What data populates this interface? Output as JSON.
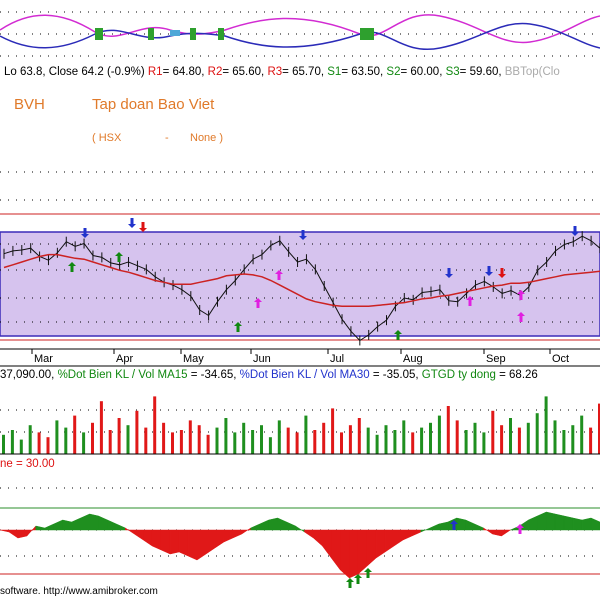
{
  "header": {
    "lo": "Lo 63.8,",
    "close": "Close 64.2 (-0.9%)",
    "r1_label": "R1",
    "r1": "= 64.80,",
    "r2_label": "R2",
    "r2": "= 65.60,",
    "r3_label": "R3",
    "r3": "= 65.70,",
    "s1_label": "S1",
    "s1": "= 63.50,",
    "s2_label": "S2",
    "s2": "= 60.00,",
    "s3_label": "S3",
    "s3": "= 59.60,",
    "bbtop": "BBTop(Clo"
  },
  "ticker": {
    "symbol": "BVH",
    "company": "Tap doan Bao Viet",
    "exchange": "( HSX",
    "dash": "-",
    "sector": "None )"
  },
  "volume_header": {
    "vol": "37,090.00,",
    "ma15_label": "%Dot Bien KL / Vol MA15",
    "ma15": "= -34.65,",
    "ma30_label": "%Dot Bien KL / Vol MA30",
    "ma30": "= -35.05,",
    "gtgd_label": "GTGD ty dong",
    "gtgd": "= 68.26"
  },
  "oscillator_header": {
    "text": "ne = 30.00"
  },
  "footer": {
    "text": "software. http://www.amibroker.com"
  },
  "colors": {
    "channel_fill": "#d6c3ee",
    "channel_line": "#3b2bb8",
    "ma_red": "#cc2222",
    "osc_green": "#1f8f1f",
    "osc_red": "#e01818",
    "title_orange": "#e07a2a",
    "label_red": "#d11",
    "label_blue": "#2233cc",
    "label_green": "#118811"
  },
  "chart_data": [
    {
      "type": "line",
      "panel": "price",
      "x_tick_labels": [
        "Mar",
        "Apr",
        "May",
        "Jun",
        "Jul",
        "Aug",
        "Sep",
        "Oct"
      ],
      "series": [
        {
          "values": [
            60.5,
            60.8,
            60.9,
            61.1,
            60.2,
            59.8,
            60.6,
            61.8,
            61.3,
            61.6,
            60.3,
            60.1,
            59.5,
            59.3,
            59.6,
            59.2,
            58.8,
            58.0,
            57.4,
            57.1,
            56.6,
            55.9,
            54.4,
            53.8,
            55.3,
            56.6,
            57.6,
            58.8,
            59.9,
            60.4,
            61.4,
            61.9,
            60.7,
            59.6,
            59.9,
            58.8,
            57.0,
            55.2,
            53.4,
            52.1,
            51.1,
            51.7,
            52.6,
            53.3,
            54.8,
            55.7,
            55.5,
            56.3,
            56.4,
            56.6,
            55.4,
            55.3,
            56.2,
            57.1,
            57.5,
            56.9,
            56.2,
            56.5,
            56.0,
            56.9,
            58.7,
            59.6,
            60.8,
            61.5,
            61.8,
            62.4,
            61.9,
            61.1
          ]
        },
        {
          "values": [
            59.0,
            59.3,
            59.6,
            59.9,
            60.2,
            60.4,
            60.4,
            60.2,
            60.0,
            59.9,
            59.6,
            59.3,
            59.0,
            58.7,
            58.5,
            58.2,
            57.9,
            57.6,
            57.4,
            57.2,
            57.2,
            57.2,
            57.4,
            57.6,
            57.8,
            58.1,
            58.2,
            58.3,
            58.2,
            58.0,
            57.6,
            57.1,
            56.6,
            56.1,
            55.6,
            55.3,
            55.1,
            54.9,
            54.8,
            54.8,
            54.8,
            54.8,
            54.9,
            55.0,
            55.1,
            55.2,
            55.4,
            55.6,
            55.7,
            55.9,
            56.0,
            56.2,
            56.4,
            56.6,
            56.8,
            57.0,
            57.1,
            57.3,
            57.3,
            57.4,
            57.6,
            57.8,
            58.0,
            58.2,
            58.3,
            58.4,
            58.5,
            58.6
          ]
        }
      ]
    },
    {
      "type": "bar",
      "panel": "volume",
      "values": [
        8,
        10,
        6,
        12,
        9,
        7,
        14,
        11,
        16,
        9,
        13,
        22,
        10,
        15,
        12,
        18,
        11,
        24,
        13,
        9,
        10,
        14,
        12,
        8,
        11,
        15,
        9,
        13,
        10,
        12,
        7,
        14,
        11,
        9,
        16,
        10,
        13,
        19,
        9,
        12,
        15,
        11,
        8,
        12,
        10,
        14,
        9,
        11,
        13,
        16,
        20,
        14,
        10,
        13,
        9,
        18,
        12,
        15,
        11,
        13,
        17,
        24,
        14,
        10,
        12,
        16,
        11,
        21
      ]
    },
    {
      "type": "area",
      "panel": "oscillator",
      "values": [
        0,
        -1,
        -4,
        -3,
        2,
        1,
        3,
        5,
        4,
        6,
        8,
        7,
        5,
        3,
        1,
        -2,
        -5,
        -8,
        -10,
        -12,
        -11,
        -13,
        -15,
        -12,
        -9,
        -6,
        -4,
        -2,
        1,
        3,
        5,
        6,
        4,
        2,
        -1,
        -4,
        -8,
        -14,
        -20,
        -24,
        -22,
        -18,
        -14,
        -11,
        -8,
        -5,
        -3,
        -1,
        1,
        3,
        4,
        6,
        5,
        3,
        1,
        -2,
        -3,
        0,
        2,
        5,
        7,
        9,
        8,
        7,
        6,
        5,
        6,
        4
      ]
    }
  ]
}
